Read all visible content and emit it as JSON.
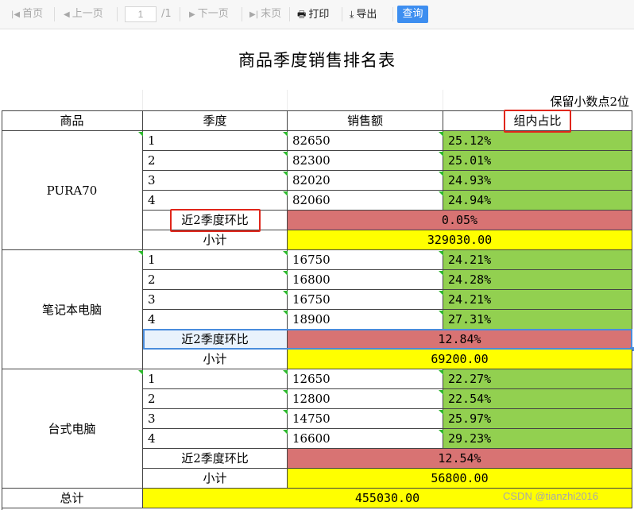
{
  "toolbar": {
    "first": "首页",
    "prev": "上一页",
    "page_value": "1",
    "page_total": "/1",
    "next": "下一页",
    "last": "末页",
    "print": "打印",
    "export": "导出",
    "query": "查询"
  },
  "report": {
    "title": "商品季度销售排名表",
    "note": "保留小数点2位",
    "headers": [
      "商品",
      "季度",
      "销售额",
      "组内占比"
    ],
    "groups": [
      {
        "name": "PURA70",
        "rows": [
          {
            "quarter": "1",
            "sales": "82650",
            "ratio": "25.12%"
          },
          {
            "quarter": "2",
            "sales": "82300",
            "ratio": "25.01%"
          },
          {
            "quarter": "3",
            "sales": "82020",
            "ratio": "24.93%"
          },
          {
            "quarter": "4",
            "sales": "82060",
            "ratio": "24.94%"
          }
        ],
        "qoq_label": "近2季度环比",
        "qoq_value": "0.05%",
        "subtotal_label": "小计",
        "subtotal_value": "329030.00"
      },
      {
        "name": "笔记本电脑",
        "rows": [
          {
            "quarter": "1",
            "sales": "16750",
            "ratio": "24.21%"
          },
          {
            "quarter": "2",
            "sales": "16800",
            "ratio": "24.28%"
          },
          {
            "quarter": "3",
            "sales": "16750",
            "ratio": "24.21%"
          },
          {
            "quarter": "4",
            "sales": "18900",
            "ratio": "27.31%"
          }
        ],
        "qoq_label": "近2季度环比",
        "qoq_value": "12.84%",
        "subtotal_label": "小计",
        "subtotal_value": "69200.00"
      },
      {
        "name": "台式电脑",
        "rows": [
          {
            "quarter": "1",
            "sales": "12650",
            "ratio": "22.27%"
          },
          {
            "quarter": "2",
            "sales": "12800",
            "ratio": "22.54%"
          },
          {
            "quarter": "3",
            "sales": "14750",
            "ratio": "25.97%"
          },
          {
            "quarter": "4",
            "sales": "16600",
            "ratio": "29.23%"
          }
        ],
        "qoq_label": "近2季度环比",
        "qoq_value": "12.54%",
        "subtotal_label": "小计",
        "subtotal_value": "56800.00"
      }
    ],
    "total_label": "总计",
    "total_value": "455030.00"
  },
  "colors": {
    "ratio_green": "#92d050",
    "qoq_red": "#d87373",
    "total_yellow": "#ffff00",
    "query_blue": "#3d8ef0",
    "highlight_red_border": "#e0261b"
  },
  "watermark": "CSDN @tianzhi2016"
}
